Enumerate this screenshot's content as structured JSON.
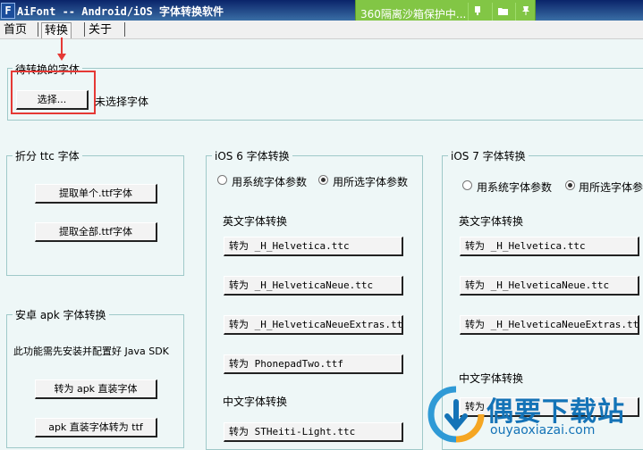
{
  "window": {
    "title": "AiFont -- Android/iOS 字体转换软件",
    "icon_letter": "F"
  },
  "sandbox": {
    "text": "360隔离沙箱保护中...",
    "icons": [
      "pin-icon",
      "folder-icon",
      "thumbtack-icon"
    ]
  },
  "menu": {
    "items": [
      "首页",
      "转换",
      "关于"
    ],
    "active": "转换"
  },
  "pending": {
    "group_label": "待转换的字体",
    "select_button": "选择...",
    "status": "未选择字体"
  },
  "split_ttc": {
    "label": "折分 ttc 字体",
    "extract_one": "提取单个.ttf字体",
    "extract_all": "提取全部.ttf字体"
  },
  "android_apk": {
    "label": "安卓 apk 字体转换",
    "note": "此功能需先安装并配置好 Java SDK",
    "to_apk": "转为 apk 直装字体",
    "apk_to_ttf": "apk 直装字体转为 ttf"
  },
  "ios6": {
    "label": "iOS 6 字体转换",
    "radio_system": "用系统字体参数",
    "radio_selected": "用所选字体参数",
    "english_label": "英文字体转换",
    "btn_helvetica": "转为 _H_Helvetica.ttc",
    "btn_helvetica_neue": "转为 _H_HelveticaNeue.ttc",
    "btn_helvetica_neue_extras": "转为 _H_HelveticaNeueExtras.ttc",
    "btn_phonepad": "转为 PhonepadTwo.ttf",
    "chinese_label": "中文字体转换",
    "btn_stheiti_light": "转为 STHeiti-Light.ttc"
  },
  "ios7": {
    "label": "iOS 7 字体转换",
    "radio_system": "用系统字体参数",
    "radio_selected": "用所选字体参",
    "english_label": "英文字体转换",
    "btn_helvetica": "转为 _H_Helvetica.ttc",
    "btn_helvetica_neue": "转为 _H_HelveticaNeue.ttc",
    "btn_helvetica_neue_extras": "转为 _H_HelveticaNeueExtras.ttc",
    "chinese_label": "中文字体转换",
    "btn_partial": "转为"
  },
  "watermark": {
    "title": "偶要下载站",
    "url": "ouyaoxiazai.com"
  },
  "colors": {
    "titlebar": "#0a246a",
    "background": "#eef7f7",
    "highlight": "#e53935",
    "sandbox": "#82c645",
    "watermark": "#1473b7"
  }
}
